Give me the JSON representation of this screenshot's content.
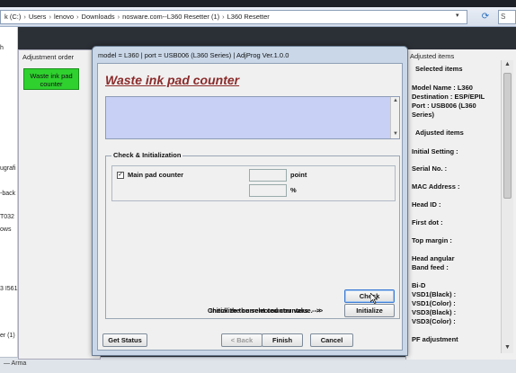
{
  "address_bar": {
    "segments": [
      "k (C:)",
      "Users",
      "lenovo",
      "Downloads",
      "nosware.com--L360 Resetter (1)",
      "L360 Resetter"
    ],
    "search_glyph": "S"
  },
  "left_strip_texts": [
    "h",
    "ugrafi",
    "-back",
    "T032",
    "ows",
    "3 I561",
    "er (1)",
    "",
    "Arma"
  ],
  "bottom_bar": {
    "text": "— Arma"
  },
  "adjustment_order": {
    "title": "Adjustment order",
    "item": "Waste ink pad counter"
  },
  "dialog": {
    "title": "model = L360 | port = USB006 (L360 Series) | AdjProg Ver.1.0.0",
    "heading": "Waste ink pad counter",
    "group_title": "Check & Initialization",
    "checkbox_label": "Main pad counter",
    "checkbox_checked": true,
    "unit_point": "point",
    "unit_percent": "%",
    "check_prompt": "Check the current counter value. -->",
    "check_button": "Check",
    "init_prompt": "Initialize the selected counters. -->",
    "init_button": "Initialize",
    "get_status_button": "Get Status",
    "back_button": "< Back",
    "finish_button": "Finish",
    "cancel_button": "Cancel"
  },
  "adjusted_items": {
    "title": "Adjusted items",
    "selected_header": "Selected items",
    "model_line1": "Model Name : L360",
    "model_line2": "Destination : ESP/EPIL",
    "model_line3": "Port : USB006 (L360",
    "model_line4": "Series)",
    "adjusted_header": "Adjusted items",
    "initial_setting": "Initial Setting :",
    "serial_no": "Serial No. :",
    "mac_address": "MAC Address :",
    "head_id": "Head ID :",
    "first_dot": "First dot :",
    "top_margin": "Top margin :",
    "head_angular1": "Head angular",
    "head_angular2": " Band feed :",
    "bid": "Bi-D",
    "vsd1_black": " VSD1(Black) :",
    "vsd1_color": " VSD1(Color) :",
    "vsd3_black": " VSD3(Black) :",
    "vsd3_color": " VSD3(Color) :",
    "pf_adjustment": "PF adjustment"
  }
}
